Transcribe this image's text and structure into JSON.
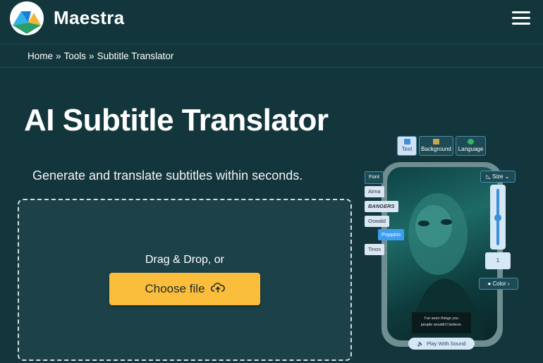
{
  "header": {
    "brand": "Maestra"
  },
  "breadcrumb": {
    "items": [
      "Home",
      "Tools",
      "Subtitle Translator"
    ],
    "separator": "»"
  },
  "hero": {
    "title": "AI Subtitle Translator",
    "subtitle": "Generate and translate subtitles within seconds."
  },
  "upload": {
    "drag_text": "Drag & Drop, or",
    "choose_label": "Choose file"
  },
  "editor_preview": {
    "tabs": [
      {
        "label": "Text",
        "active": true
      },
      {
        "label": "Background",
        "active": false
      },
      {
        "label": "Language",
        "active": false
      }
    ],
    "font_label": "Font",
    "fonts": [
      "Atma",
      "BANGERS",
      "Oswald",
      "Poppins",
      "Tinos"
    ],
    "active_font": "Poppins",
    "size_label": "Size",
    "size_value": "1",
    "color_label": "Color",
    "caption_lines": [
      "I've seen things you",
      "people wouldn't believe."
    ],
    "play_label": "Play With Sound"
  },
  "colors": {
    "background": "#12363c",
    "accent_button": "#fbbd3c",
    "active_chip": "#3d9df0"
  }
}
